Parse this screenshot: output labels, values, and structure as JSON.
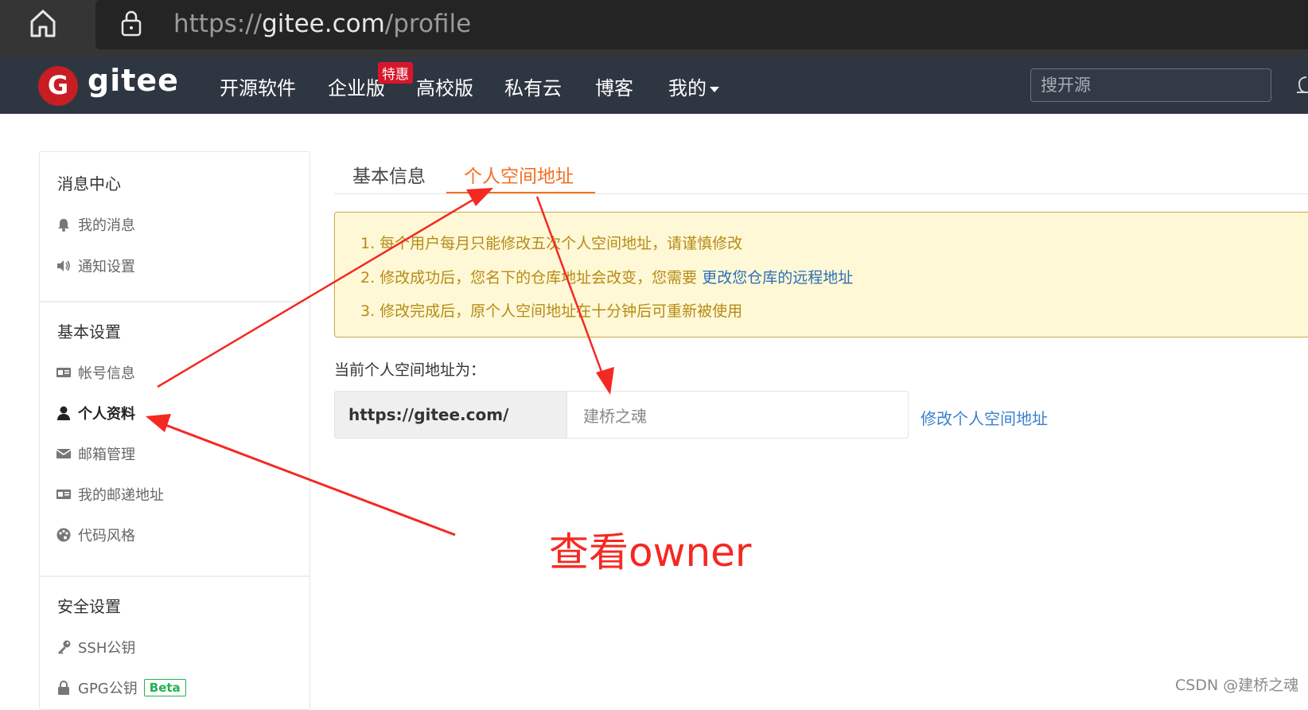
{
  "browser": {
    "url_scheme": "https://",
    "url_domain": "gitee.com",
    "url_path": "/profile"
  },
  "header": {
    "logo_text": "gitee",
    "nav": [
      "开源软件",
      "企业版",
      "高校版",
      "私有云",
      "博客",
      "我的"
    ],
    "promo_badge": "特惠",
    "search_placeholder": "搜开源"
  },
  "sidebar": {
    "sections": [
      {
        "title": "消息中心",
        "items": [
          {
            "label": "我的消息",
            "icon": "bell-icon"
          },
          {
            "label": "通知设置",
            "icon": "speaker-icon"
          }
        ]
      },
      {
        "title": "基本设置",
        "items": [
          {
            "label": "帐号信息",
            "icon": "id-card-icon"
          },
          {
            "label": "个人资料",
            "icon": "user-icon",
            "active": true
          },
          {
            "label": "邮箱管理",
            "icon": "envelope-icon"
          },
          {
            "label": "我的邮递地址",
            "icon": "id-card-icon"
          },
          {
            "label": "代码风格",
            "icon": "palette-icon"
          }
        ]
      },
      {
        "title": "安全设置",
        "items": [
          {
            "label": "SSH公钥",
            "icon": "key-icon"
          },
          {
            "label": "GPG公钥",
            "icon": "lock-icon",
            "badge": "Beta"
          }
        ]
      }
    ]
  },
  "main": {
    "tabs": [
      "基本信息",
      "个人空间地址"
    ],
    "notice": {
      "line1": "1. 每个用户每月只能修改五次个人空间地址，请谨慎修改",
      "line2_prefix": "2. 修改成功后，您名下的仓库地址会改变，您需要 ",
      "line2_link": "更改您仓库的远程地址",
      "line3": "3. 修改完成后，原个人空间地址在十分钟后可重新被使用"
    },
    "current_label": "当前个人空间地址为：",
    "url_prefix": "https://gitee.com/",
    "space_value": "建桥之魂",
    "modify_link": "修改个人空间地址"
  },
  "annotation": {
    "text": "查看owner",
    "color": "#f42922"
  },
  "watermark": "CSDN @建桥之魂",
  "colors": {
    "accent": "#f36f21",
    "header_bg": "#2e3641",
    "logo_red": "#c71d23",
    "link": "#3a7fcf"
  }
}
